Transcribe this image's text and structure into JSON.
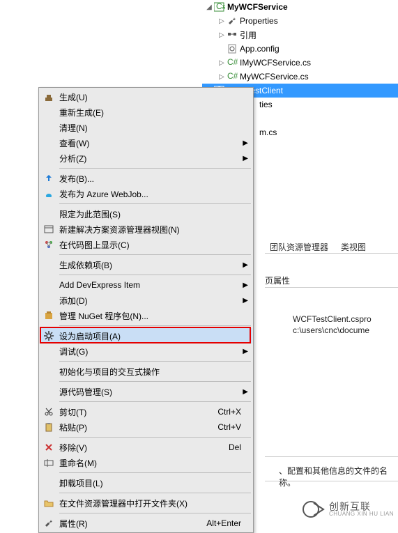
{
  "tree": {
    "project": {
      "label": "MyWCFService",
      "icon": "csharp-project"
    },
    "items": [
      {
        "label": "Properties",
        "icon": "wrench",
        "exp": "▷",
        "indent": 1
      },
      {
        "label": "引用",
        "icon": "references",
        "exp": "▷",
        "indent": 1
      },
      {
        "label": "App.config",
        "icon": "config",
        "exp": "",
        "indent": 1
      },
      {
        "label": "IMyWCFService.cs",
        "icon": "cs-file",
        "exp": "▷",
        "indent": 1
      },
      {
        "label": "MyWCFService.cs",
        "icon": "cs-file",
        "exp": "▷",
        "indent": 1
      }
    ],
    "selected": {
      "label": "WCFTestClient",
      "icon": "csharp-project",
      "exp": "◢",
      "indent": 0
    },
    "peek1": "ties",
    "peek2": "m.cs"
  },
  "tabs": {
    "team_explorer": "团队资源管理器",
    "class_view": "类视图"
  },
  "prop_panel": {
    "header_suffix": "页属性",
    "file": "WCFTestClient.cspro",
    "path": "c:\\users\\cnc\\docume"
  },
  "bottom": {
    "text": "、配置和其他信息的文件的名称。"
  },
  "menu": {
    "items": [
      {
        "label": "生成(U)",
        "icon": "build"
      },
      {
        "label": "重新生成(E)",
        "icon": ""
      },
      {
        "label": "清理(N)",
        "icon": ""
      },
      {
        "label": "查看(W)",
        "icon": "",
        "submenu": true
      },
      {
        "label": "分析(Z)",
        "icon": "",
        "submenu": true
      },
      {
        "sep": true
      },
      {
        "label": "发布(B)...",
        "icon": "publish"
      },
      {
        "label": "发布为 Azure WebJob...",
        "icon": "azure"
      },
      {
        "sep": true
      },
      {
        "label": "限定为此范围(S)",
        "icon": ""
      },
      {
        "label": "新建解决方案资源管理器视图(N)",
        "icon": "new-view"
      },
      {
        "label": "在代码图上显示(C)",
        "icon": "codemap"
      },
      {
        "sep": true
      },
      {
        "label": "生成依赖项(B)",
        "icon": "",
        "submenu": true
      },
      {
        "sep": true
      },
      {
        "label": "Add DevExpress Item",
        "icon": "",
        "submenu": true
      },
      {
        "label": "添加(D)",
        "icon": "",
        "submenu": true
      },
      {
        "label": "管理 NuGet 程序包(N)...",
        "icon": "nuget"
      },
      {
        "sep": true
      },
      {
        "label": "设为启动项目(A)",
        "icon": "gear",
        "highlight": true
      },
      {
        "label": "调试(G)",
        "icon": "",
        "submenu": true
      },
      {
        "sep": true
      },
      {
        "label": "初始化与项目的交互式操作",
        "icon": ""
      },
      {
        "sep": true
      },
      {
        "label": "源代码管理(S)",
        "icon": "",
        "submenu": true
      },
      {
        "sep": true
      },
      {
        "label": "剪切(T)",
        "icon": "cut",
        "shortcut": "Ctrl+X"
      },
      {
        "label": "粘贴(P)",
        "icon": "paste",
        "shortcut": "Ctrl+V"
      },
      {
        "sep": true
      },
      {
        "label": "移除(V)",
        "icon": "remove",
        "shortcut": "Del"
      },
      {
        "label": "重命名(M)",
        "icon": "rename"
      },
      {
        "sep": true
      },
      {
        "label": "卸载项目(L)",
        "icon": ""
      },
      {
        "sep": true
      },
      {
        "label": "在文件资源管理器中打开文件夹(X)",
        "icon": "folder-open"
      },
      {
        "sep": true
      },
      {
        "label": "属性(R)",
        "icon": "properties",
        "shortcut": "Alt+Enter"
      }
    ]
  },
  "watermark": {
    "main": "创新互联",
    "sub": "CHUANG XIN HU LIAN"
  }
}
